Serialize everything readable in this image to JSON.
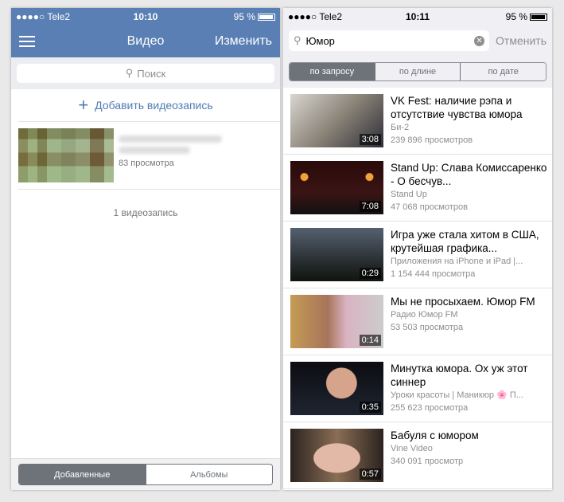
{
  "left": {
    "status": {
      "carrier": "●●●●○ Tele2",
      "time": "10:10",
      "battery": "95 %"
    },
    "nav": {
      "title": "Видео",
      "edit": "Изменить"
    },
    "search_placeholder": "Поиск",
    "add_label": "Добавить видеозапись",
    "video": {
      "views": "83 просмотра"
    },
    "count": "1 видеозапись",
    "tabs": [
      {
        "label": "Добавленные",
        "active": true
      },
      {
        "label": "Альбомы",
        "active": false
      }
    ]
  },
  "right": {
    "status": {
      "carrier": "●●●●○ Tele2",
      "time": "10:11",
      "battery": "95 %"
    },
    "search_value": "Юмор",
    "cancel": "Отменить",
    "sort": [
      {
        "label": "по запросу",
        "active": true
      },
      {
        "label": "по длине",
        "active": false
      },
      {
        "label": "по дате",
        "active": false
      }
    ],
    "videos": [
      {
        "title": "VK Fest: наличие рэпа и отсутствие чувства юмора",
        "author": "Би-2",
        "views": "239 896 просмотров",
        "duration": "3:08"
      },
      {
        "title": "Stand Up: Слава Комиссаренко - О бесчув...",
        "author": "Stand Up",
        "views": "47 068 просмотров",
        "duration": "7:08"
      },
      {
        "title": "Игра уже стала хитом в США, крутейшая графика...",
        "author": "Приложения на iPhone и iPad |...",
        "views": "1 154 444 просмотра",
        "duration": "0:29"
      },
      {
        "title": "Мы не просыхаем. Юмор FM",
        "author": "Радио Юмор FM",
        "views": "53 503 просмотра",
        "duration": "0:14"
      },
      {
        "title": "Минутка юмора. Ох уж этот синнер",
        "author": "Уроки красоты | Маникюр 🌸 П...",
        "views": "255 623 просмотра",
        "duration": "0:35"
      },
      {
        "title": "Бабуля с юмором",
        "author": "Vine Video",
        "views": "340 091 просмотр",
        "duration": "0:57"
      }
    ]
  }
}
